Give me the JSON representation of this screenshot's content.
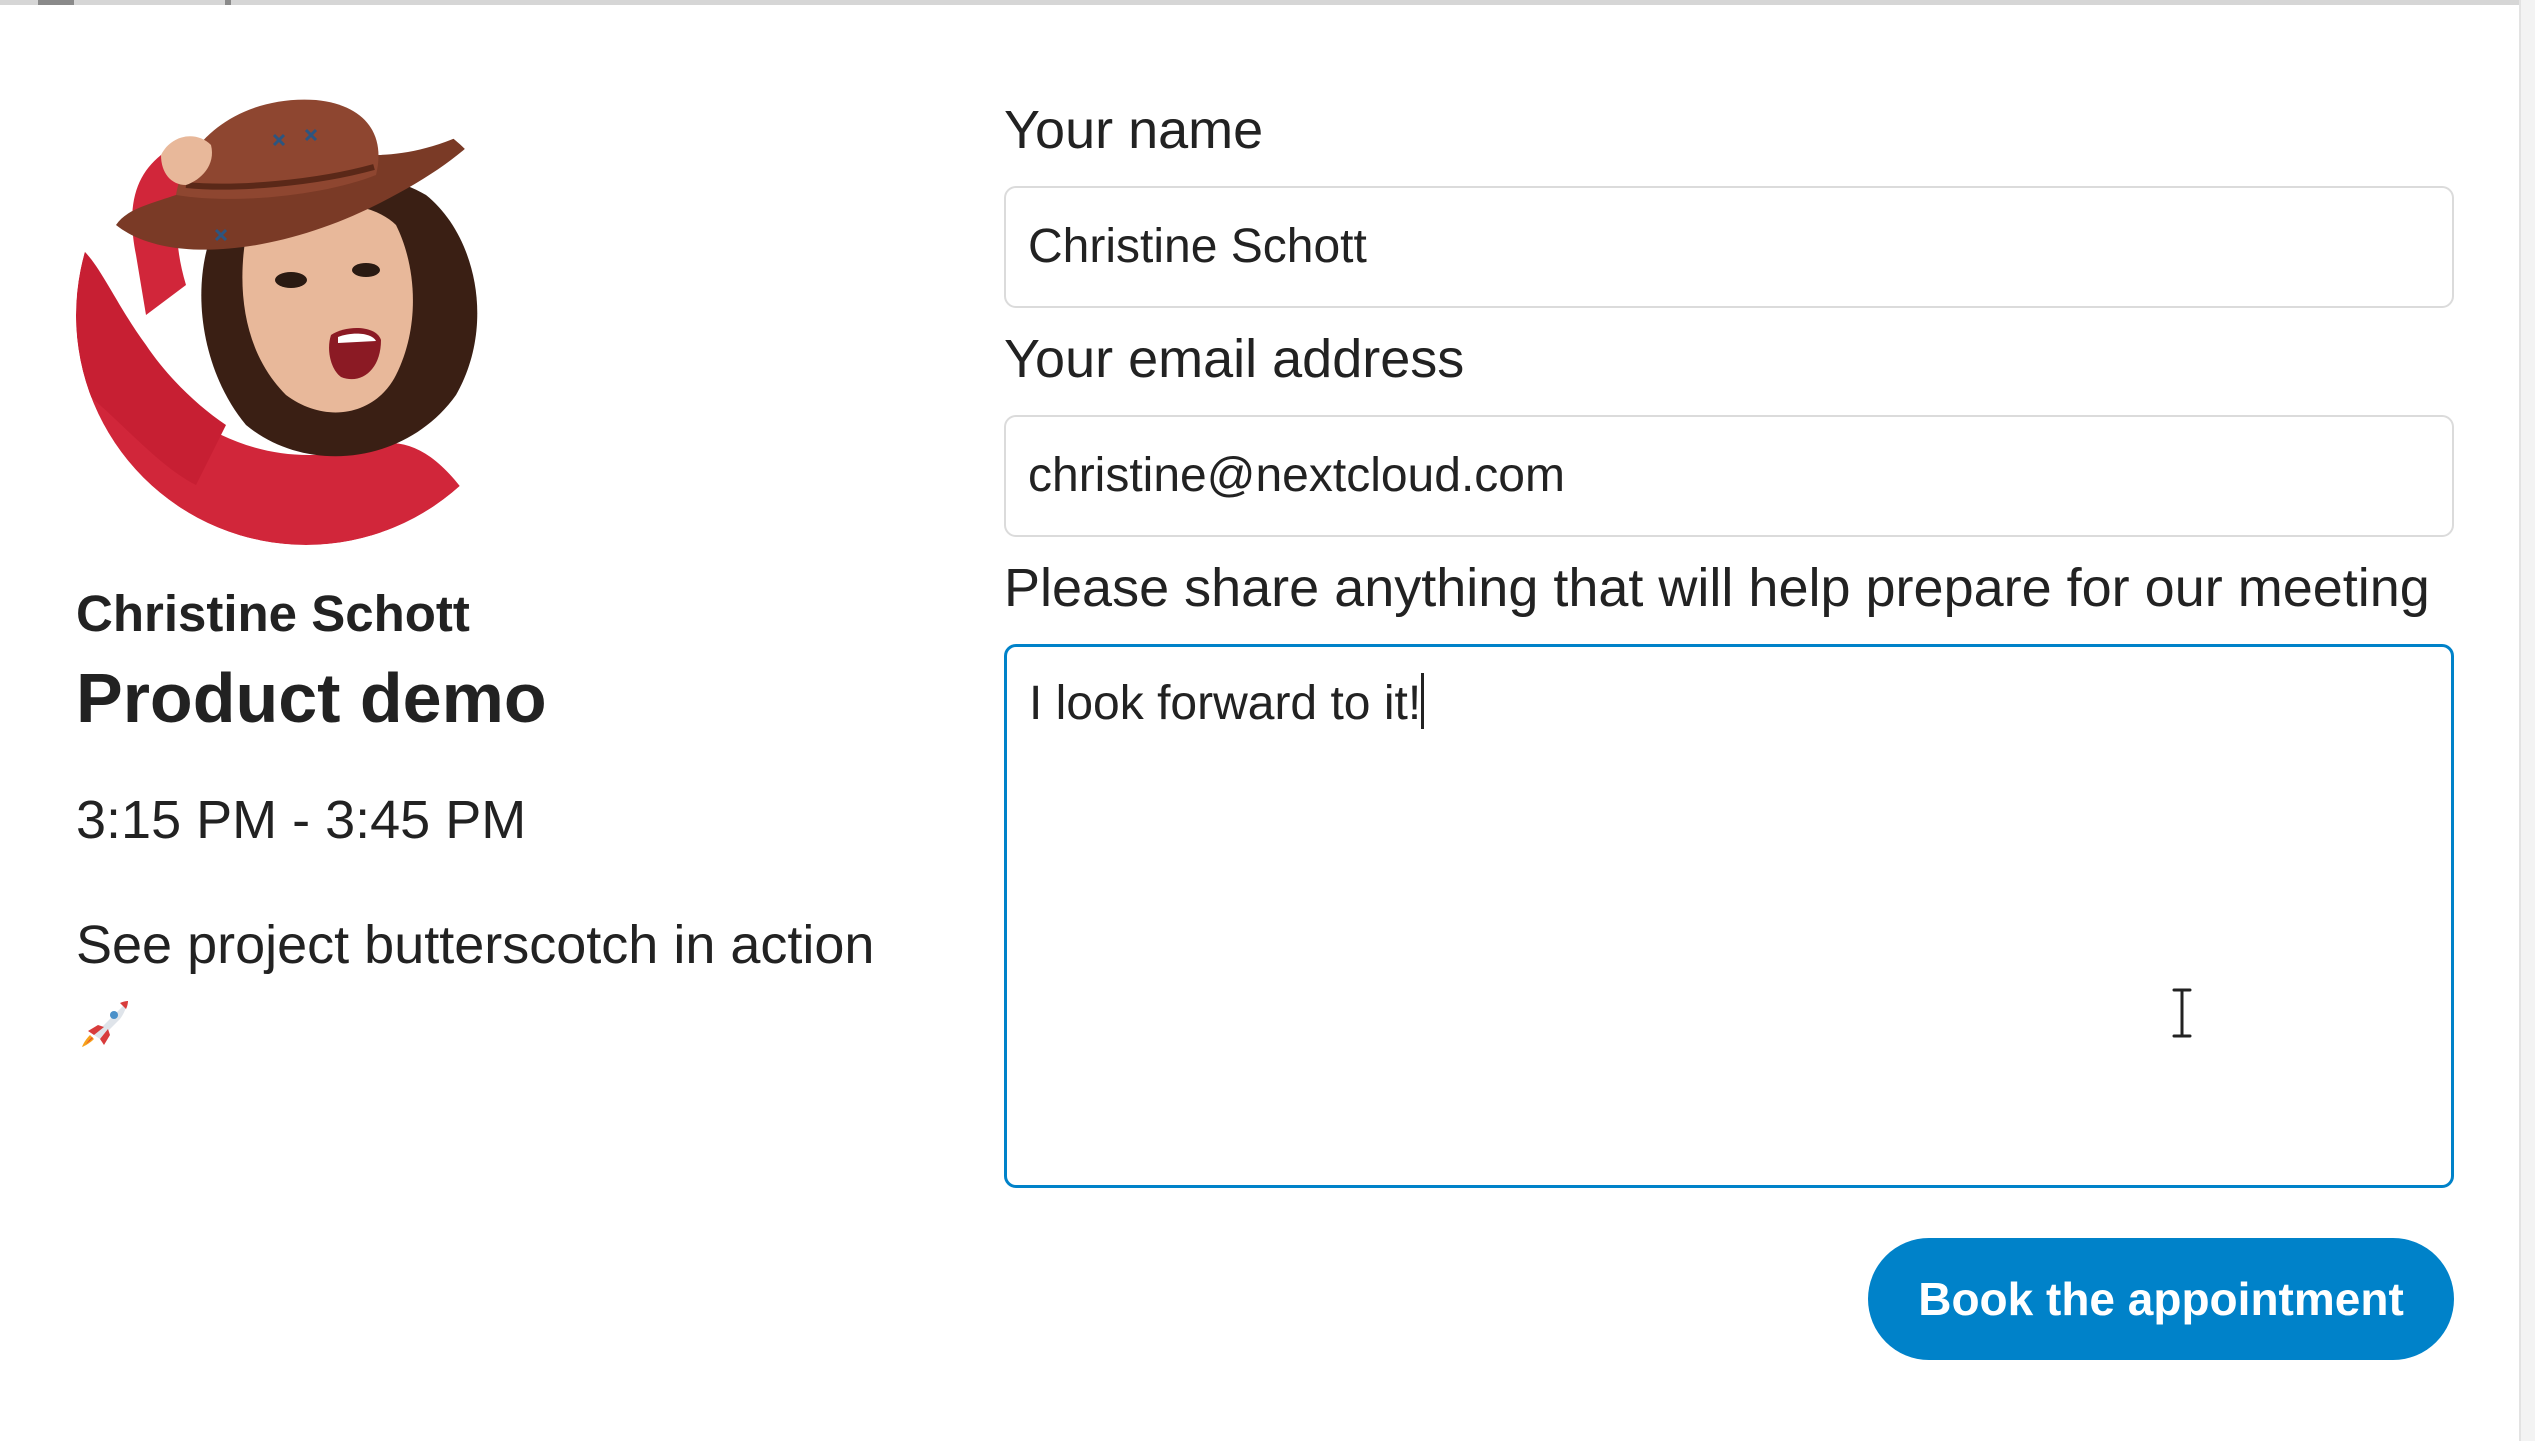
{
  "organizer": {
    "name": "Christine Schott",
    "avatar_icon": "avatar-photo"
  },
  "appointment": {
    "title": "Product demo",
    "time_range": "3:15 PM - 3:45 PM",
    "description": "See project butterscotch in action",
    "description_emoji_icon": "rocket-icon"
  },
  "form": {
    "name_label": "Your name",
    "name_value": "Christine Schott",
    "email_label": "Your email address",
    "email_value": "christine@nextcloud.com",
    "notes_label": "Please share anything that will help prepare for our meeting",
    "notes_value": "I look forward to it!",
    "submit_label": "Book the appointment"
  },
  "colors": {
    "accent": "#0082c9",
    "text": "#222222",
    "border": "#dbdbdb"
  }
}
